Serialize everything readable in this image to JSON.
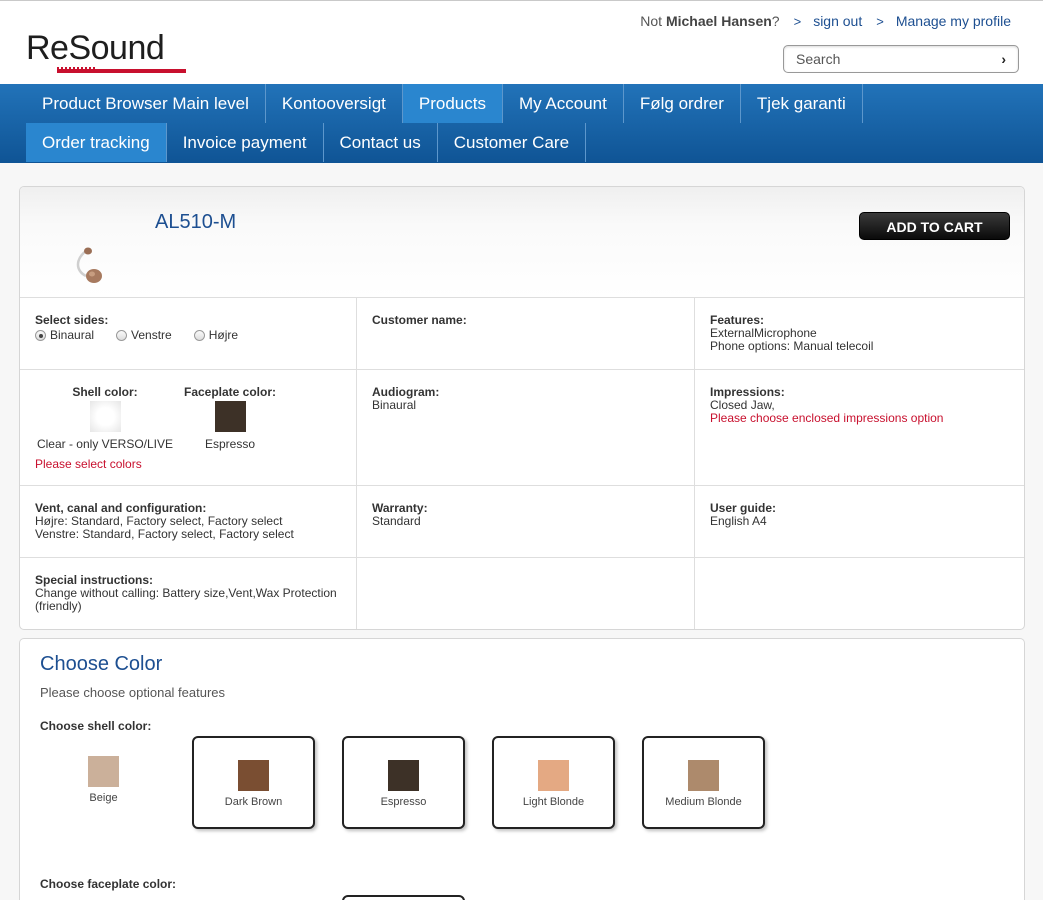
{
  "header": {
    "logo_text": "ReSound",
    "not_prefix": "Not",
    "user_name": "Michael Hansen",
    "question": "?",
    "sign_out": "sign out",
    "manage_profile": "Manage my profile",
    "search_placeholder": "Search"
  },
  "nav": {
    "row1": [
      "Product Browser Main level",
      "Kontooversigt",
      "Products",
      "My Account",
      "Følg ordrer",
      "Tjek garanti"
    ],
    "row2": [
      "Order tracking",
      "Invoice payment",
      "Contact us",
      "Customer Care"
    ],
    "active": [
      "Products",
      "Order tracking"
    ]
  },
  "product": {
    "title": "AL510-M",
    "add_to_cart": "ADD TO CART",
    "select_sides": {
      "label": "Select sides:",
      "options": [
        "Binaural",
        "Venstre",
        "Højre"
      ],
      "selected": "Binaural"
    },
    "customer_name": {
      "label": "Customer name:",
      "value": ""
    },
    "features": {
      "label": "Features:",
      "lines": [
        "ExternalMicrophone",
        "Phone options: Manual telecoil"
      ]
    },
    "shell_color": {
      "label": "Shell color:",
      "value": "Clear - only VERSO/LIVE",
      "swatch": "#f2f2f2"
    },
    "faceplate_color": {
      "label": "Faceplate color:",
      "value": "Espresso",
      "swatch": "#3d3127"
    },
    "colors_warning": "Please select colors",
    "audiogram": {
      "label": "Audiogram:",
      "value": "Binaural"
    },
    "impressions": {
      "label": "Impressions:",
      "value": "Closed Jaw,",
      "warning": "Please choose enclosed impressions option"
    },
    "vent": {
      "label": "Vent, canal and configuration:",
      "lines": [
        "Højre: Standard, Factory select, Factory select",
        "Venstre: Standard, Factory select, Factory select"
      ]
    },
    "warranty": {
      "label": "Warranty:",
      "value": "Standard"
    },
    "user_guide": {
      "label": "User guide:",
      "value": "English A4"
    },
    "special": {
      "label": "Special instructions:",
      "lines": [
        "Change without calling: Battery size,Vent,Wax Protection",
        "(friendly)"
      ]
    }
  },
  "choose_color": {
    "title": "Choose Color",
    "subtitle": "Please choose optional features",
    "shell_label": "Choose shell color:",
    "faceplate_label": "Choose faceplate color:",
    "shell_options": [
      {
        "name": "Beige",
        "color": "#cbb09a"
      },
      {
        "name": "Dark Brown",
        "color": "#7a4e32"
      },
      {
        "name": "Espresso",
        "color": "#3d3127"
      },
      {
        "name": "Light Blonde",
        "color": "#e4a983"
      },
      {
        "name": "Medium Blonde",
        "color": "#ad8a6c"
      }
    ]
  },
  "colors": {
    "brand_blue": "#1d4f91",
    "nav_blue": "#1560a8",
    "warning_red": "#c8102e"
  }
}
